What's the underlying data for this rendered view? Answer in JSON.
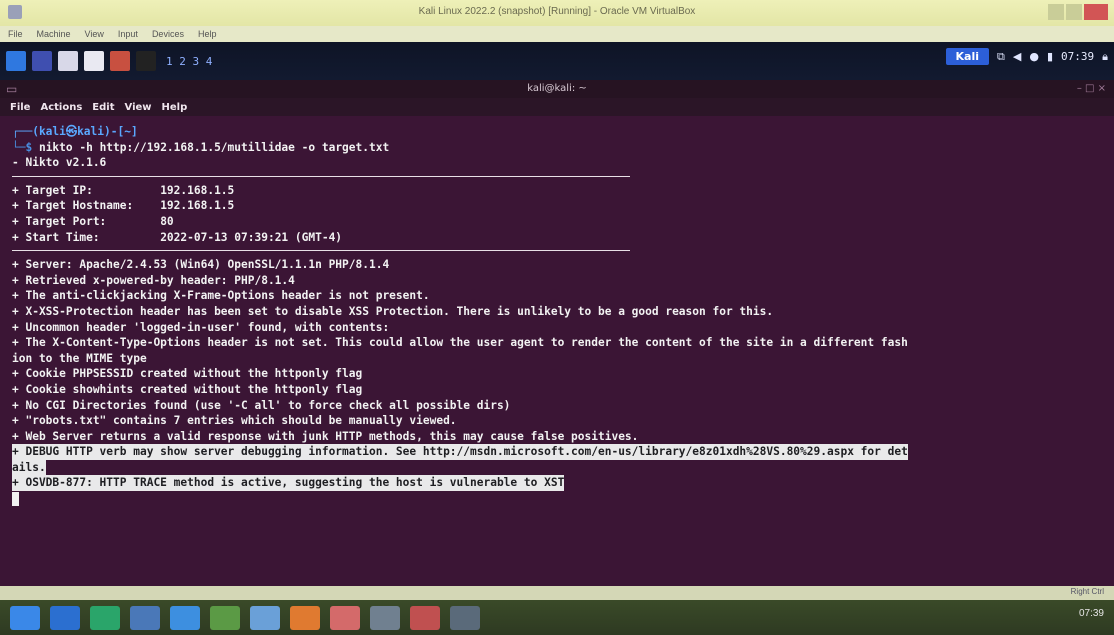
{
  "vbox": {
    "title": "Kali Linux 2022.2 (snapshot) [Running] - Oracle VM VirtualBox",
    "menu": [
      "File",
      "Machine",
      "View",
      "Input",
      "Devices",
      "Help"
    ],
    "host_key": "Right Ctrl"
  },
  "panel": {
    "workspaces": "1  2  3  4",
    "tray_label": "Kali",
    "clock": "07:39"
  },
  "terminal": {
    "title": "kali@kali: ~",
    "menu": [
      "File",
      "Actions",
      "Edit",
      "View",
      "Help"
    ],
    "prompt_line1": "┌──(kali㉿kali)-[~]",
    "prompt_dollar": "└─$ ",
    "command": "nikto -h http://192.168.1.5/mutillidae -o target.txt",
    "version": "- Nikto v2.1.6",
    "target_info": [
      {
        "key": "+ Target IP:          ",
        "value": "192.168.1.5"
      },
      {
        "key": "+ Target Hostname:    ",
        "value": "192.168.1.5"
      },
      {
        "key": "+ Target Port:        ",
        "value": "80"
      },
      {
        "key": "+ Start Time:         ",
        "value": "2022-07-13 07:39:21 (GMT-4)"
      }
    ],
    "findings": [
      "+ Server: Apache/2.4.53 (Win64) OpenSSL/1.1.1n PHP/8.1.4",
      "+ Retrieved x-powered-by header: PHP/8.1.4",
      "+ The anti-clickjacking X-Frame-Options header is not present.",
      "+ X-XSS-Protection header has been set to disable XSS Protection. There is unlikely to be a good reason for this.",
      "+ Uncommon header 'logged-in-user' found, with contents:",
      "+ The X-Content-Type-Options header is not set. This could allow the user agent to render the content of the site in a different fash",
      "ion to the MIME type",
      "+ Cookie PHPSESSID created without the httponly flag",
      "+ Cookie showhints created without the httponly flag",
      "+ No CGI Directories found (use '-C all' to force check all possible dirs)",
      "+ \"robots.txt\" contains 7 entries which should be manually viewed."
    ],
    "highlighted": [
      "+ Web Server returns a valid response with junk HTTP methods, this may cause false positives.",
      "+ DEBUG HTTP verb may show server debugging information. See http://msdn.microsoft.com/en-us/library/e8z01xdh%28VS.80%29.aspx for det",
      "ails.",
      "+ OSVDB-877: HTTP TRACE method is active, suggesting the host is vulnerable to XST"
    ]
  },
  "taskbar": {
    "clock": "07:39"
  },
  "colors": {
    "terminal_bg": "#3b1535",
    "vbox_title_bg": "#e3e6a6",
    "panel_bg": "#121a30",
    "taskbar_bg": "#2e3a22"
  }
}
